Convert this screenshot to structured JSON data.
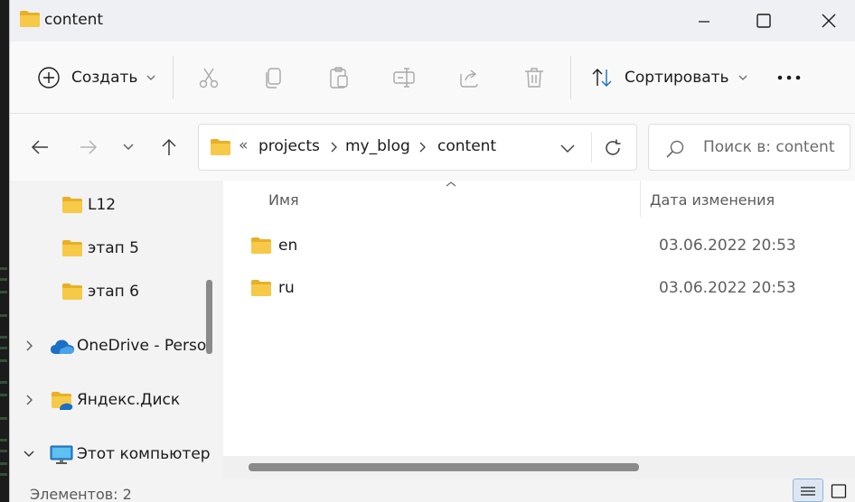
{
  "window": {
    "title": "content"
  },
  "toolbar": {
    "create_label": "Создать",
    "sort_label": "Сортировать",
    "more_label": "•••"
  },
  "address": {
    "overflow": "«",
    "crumbs": [
      "projects",
      "my_blog",
      "content"
    ]
  },
  "search": {
    "placeholder": "Поиск в: content"
  },
  "sidebar": {
    "items": [
      {
        "label": "L12"
      },
      {
        "label": "этап 5"
      },
      {
        "label": "этап 6"
      },
      {
        "label": "OneDrive - Perso"
      },
      {
        "label": "Яндекс.Диск"
      },
      {
        "label": "Этот компьютер"
      }
    ]
  },
  "columns": {
    "name": "Имя",
    "modified": "Дата изменения"
  },
  "files": [
    {
      "name": "en",
      "modified": "03.06.2022 20:53"
    },
    {
      "name": "ru",
      "modified": "03.06.2022 20:53"
    }
  ],
  "status": {
    "count": "Элементов: 2"
  },
  "colors": {
    "folder": "#f7c948",
    "folder_dark": "#e8b026",
    "accent": "#1b6fc5"
  }
}
